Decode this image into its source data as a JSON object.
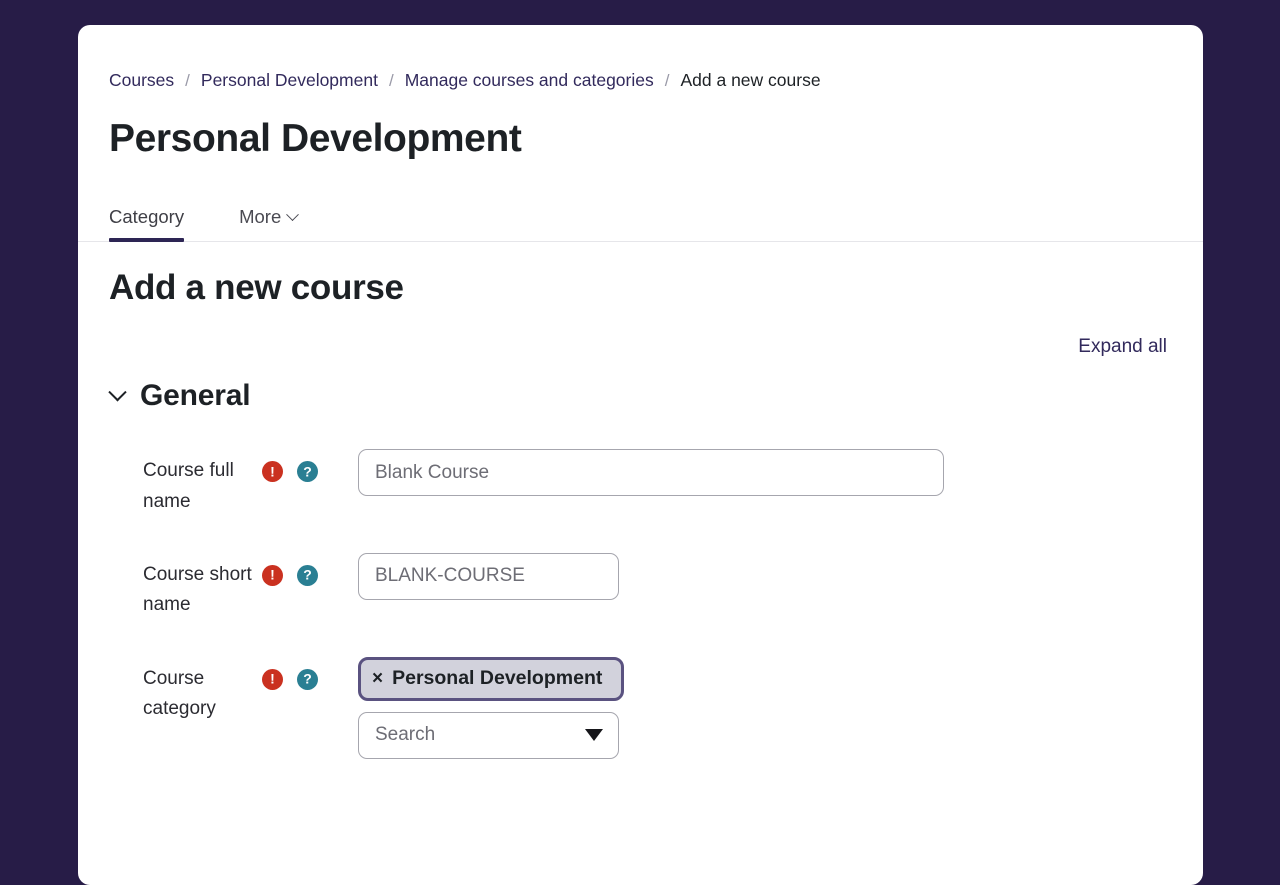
{
  "theme": {
    "page_background": "#271c47",
    "card_background": "#ffffff",
    "link_color": "#322a5c",
    "accent_underline": "#2d2554",
    "required_badge_color": "#ca3120",
    "help_badge_color": "#2a7f93",
    "chip_background": "#d2d2dc",
    "chip_border": "#5a5280"
  },
  "breadcrumb": {
    "separator": "/",
    "items": [
      {
        "label": "Courses",
        "current": false
      },
      {
        "label": "Personal Development",
        "current": false
      },
      {
        "label": "Manage courses and categories",
        "current": false
      },
      {
        "label": "Add a new course",
        "current": true
      }
    ]
  },
  "header": {
    "title": "Personal Development"
  },
  "tabs": [
    {
      "label": "Category",
      "active": true,
      "has_chevron": false
    },
    {
      "label": "More",
      "active": false,
      "has_chevron": true
    }
  ],
  "main": {
    "page_heading": "Add a new course",
    "expand_all_label": "Expand all",
    "sections": [
      {
        "title": "General",
        "expanded": true,
        "fields": [
          {
            "label": "Course full name",
            "required_badge": "!",
            "help_badge": "?",
            "control": "text",
            "value": "Blank Course",
            "placeholder": "Blank Course"
          },
          {
            "label": "Course short name",
            "required_badge": "!",
            "help_badge": "?",
            "control": "text",
            "value": "BLANK-COURSE",
            "placeholder": "BLANK-COURSE"
          },
          {
            "label": "Course category",
            "required_badge": "!",
            "help_badge": "?",
            "control": "autocomplete",
            "selected_chip": "Personal Development",
            "chip_remove_glyph": "×",
            "search_value": "",
            "search_placeholder": "Search",
            "dropdown_icon": "caret-down-icon"
          }
        ]
      }
    ]
  }
}
